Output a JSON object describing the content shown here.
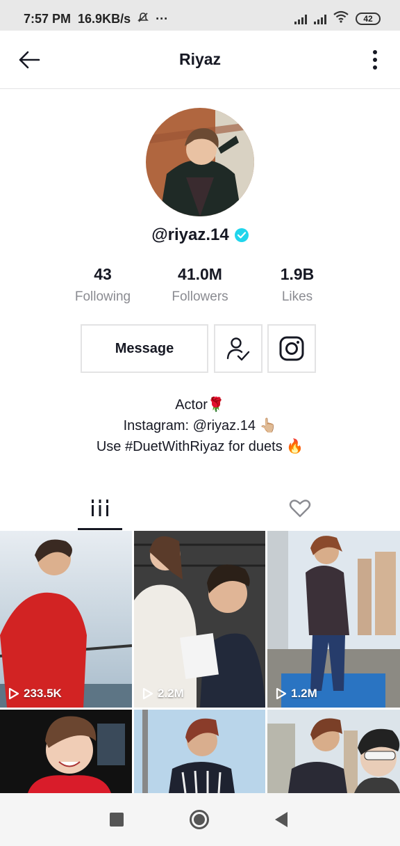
{
  "status_bar": {
    "time": "7:57 PM",
    "network_speed": "16.9KB/s",
    "more": "···",
    "battery": "42"
  },
  "header": {
    "title": "Riyaz"
  },
  "profile": {
    "username": "@riyaz.14",
    "verified": true,
    "stats": [
      {
        "value": "43",
        "label": "Following"
      },
      {
        "value": "41.0M",
        "label": "Followers"
      },
      {
        "value": "1.9B",
        "label": "Likes"
      }
    ],
    "message_label": "Message",
    "bio": [
      "Actor🌹",
      "Instagram: @riyaz.14 👆🏼",
      "Use #DuetWithRiyaz for duets 🔥"
    ]
  },
  "tabs": [
    {
      "icon": "videos-grid-icon",
      "active": true
    },
    {
      "icon": "heart-icon",
      "active": false
    }
  ],
  "videos": [
    {
      "views": "233.5K"
    },
    {
      "views": "2.2M"
    },
    {
      "views": "1.2M"
    },
    {
      "views": ""
    },
    {
      "views": ""
    },
    {
      "views": ""
    }
  ],
  "colors": {
    "verified": "#20d5ec",
    "text_primary": "#161823",
    "text_secondary": "#8a8b91",
    "border": "#e3e3e4"
  }
}
